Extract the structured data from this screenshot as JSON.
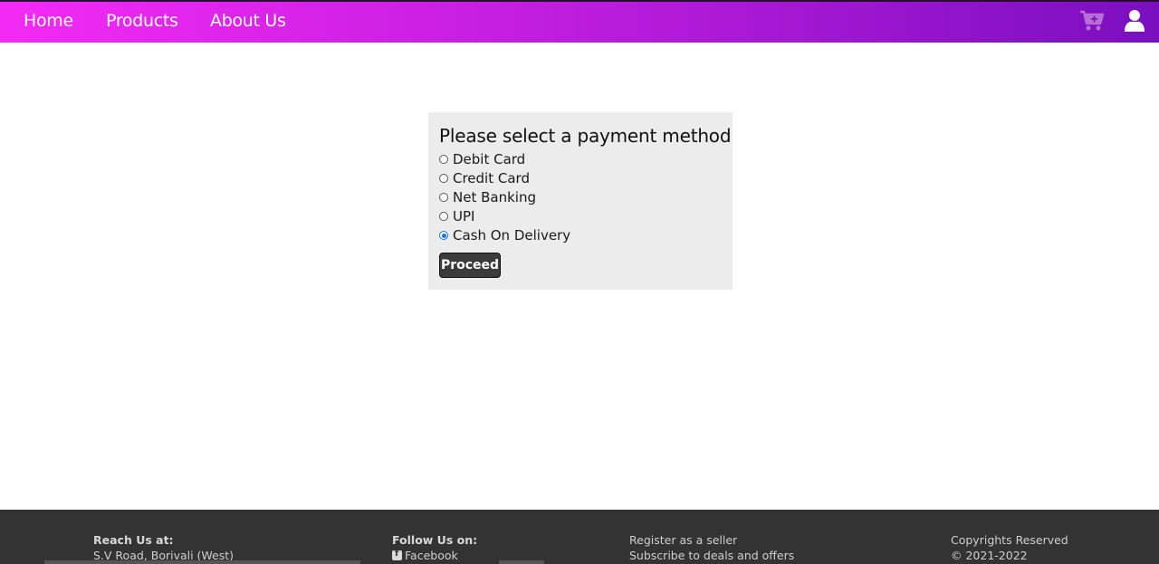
{
  "nav": {
    "home": "Home",
    "products": "Products",
    "about": "About Us",
    "cart_icon": "cart-plus-icon",
    "user_icon": "user-icon"
  },
  "payment": {
    "title": "Please select a payment method",
    "options": [
      {
        "label": "Debit Card",
        "selected": false
      },
      {
        "label": "Credit Card",
        "selected": false
      },
      {
        "label": "Net Banking",
        "selected": false
      },
      {
        "label": "UPI",
        "selected": false
      },
      {
        "label": "Cash On Delivery",
        "selected": true
      }
    ],
    "proceed_label": "Proceed"
  },
  "footer": {
    "reach": {
      "heading": "Reach Us at:",
      "address": "S.V Road, Borivali (West)"
    },
    "follow": {
      "heading": "Follow Us on:",
      "facebook": "Facebook"
    },
    "links": {
      "register": "Register as a seller",
      "subscribe": "Subscribe to deals and offers"
    },
    "copyright": {
      "line1": "Copyrights Reserved",
      "line2": "© 2021-2022"
    }
  },
  "colors": {
    "nav_gradient_start": "#f32af5",
    "nav_gradient_end": "#7a0fbf",
    "panel_bg": "#ececec",
    "button_bg": "#3b3b3b",
    "footer_bg": "#333333",
    "radio_selected": "#1a73e8"
  }
}
